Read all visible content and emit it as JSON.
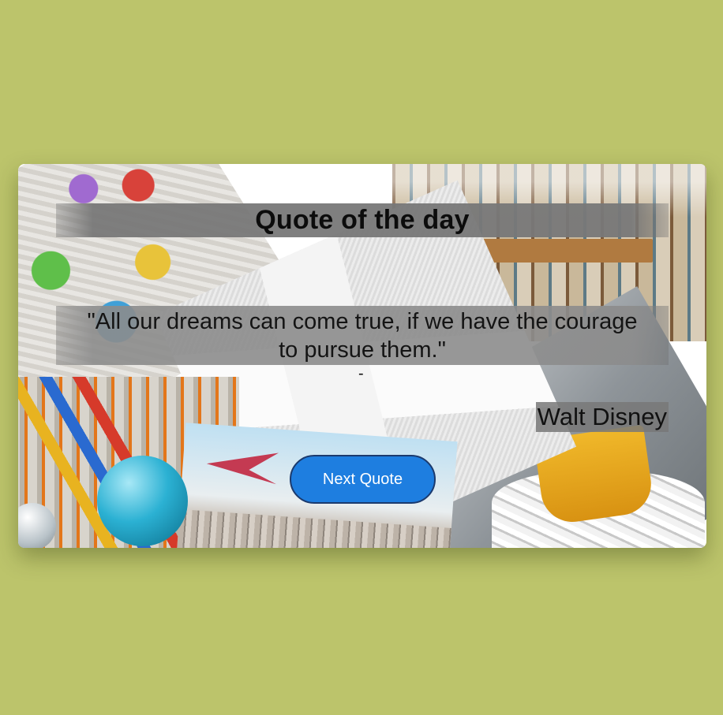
{
  "card": {
    "title": "Quote of the day",
    "quote_text": "\"All our dreams can come true, if we have the courage to pursue them.\"",
    "separator": "-",
    "author": "Walt Disney",
    "next_button_label": "Next Quote"
  },
  "colors": {
    "page_background": "#bcc46b",
    "button_background": "#1e7ee0",
    "button_text": "#ffffff"
  }
}
